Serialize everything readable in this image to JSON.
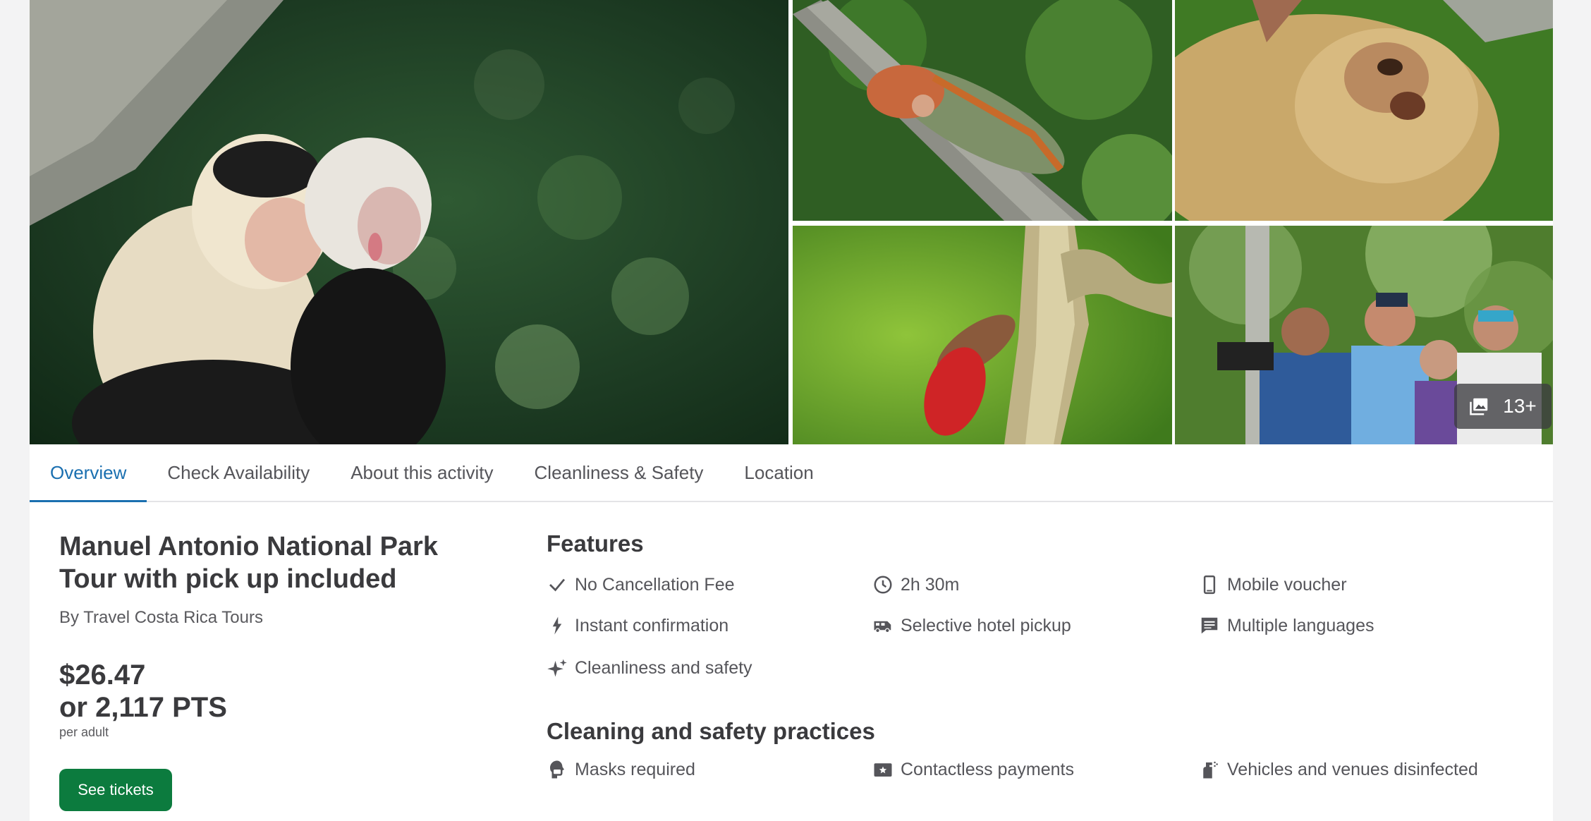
{
  "gallery": {
    "more_count": "13+"
  },
  "tabs": [
    {
      "label": "Overview",
      "active": true
    },
    {
      "label": "Check Availability"
    },
    {
      "label": "About this activity"
    },
    {
      "label": "Cleanliness & Safety"
    },
    {
      "label": "Location"
    }
  ],
  "product": {
    "title": "Manuel Antonio National Park Tour with pick up included",
    "operator": "By Travel Costa Rica Tours",
    "price": "$26.47",
    "points": "or 2,117 PTS",
    "per_unit": "per adult",
    "cta_label": "See tickets"
  },
  "features": {
    "heading": "Features",
    "items": [
      {
        "icon": "check-icon",
        "label": "No Cancellation Fee"
      },
      {
        "icon": "clock-icon",
        "label": "2h 30m"
      },
      {
        "icon": "mobile-phone-icon",
        "label": "Mobile voucher"
      },
      {
        "icon": "lightning-icon",
        "label": "Instant confirmation"
      },
      {
        "icon": "van-icon",
        "label": "Selective hotel pickup"
      },
      {
        "icon": "chat-icon",
        "label": "Multiple languages"
      },
      {
        "icon": "sparkle-icon",
        "label": "Cleanliness and safety"
      }
    ]
  },
  "safety": {
    "heading": "Cleaning and safety practices",
    "items": [
      {
        "icon": "mask-icon",
        "label": "Masks required"
      },
      {
        "icon": "payment-card-icon",
        "label": "Contactless payments"
      },
      {
        "icon": "spray-bottle-icon",
        "label": "Vehicles and venues disinfected"
      }
    ]
  },
  "colors": {
    "accent": "#1a6fb0",
    "cta": "#0c7b3e",
    "text": "#3d3d40"
  }
}
